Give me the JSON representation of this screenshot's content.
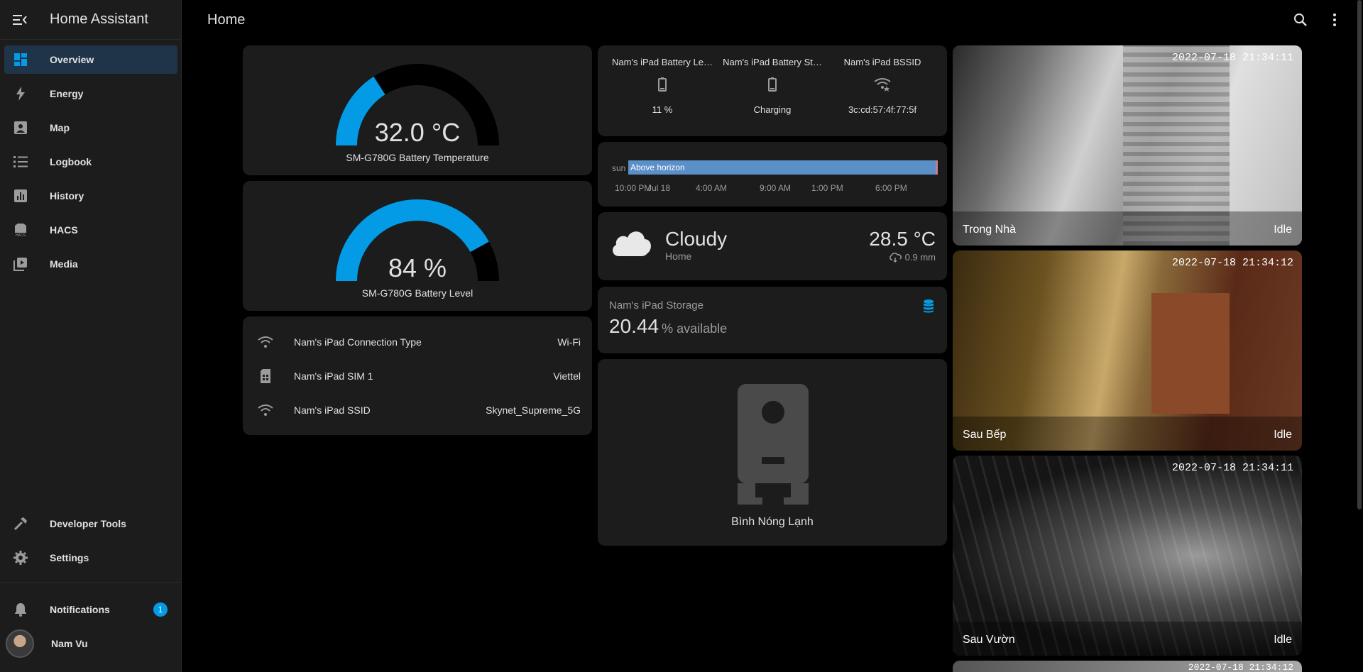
{
  "app": {
    "title": "Home Assistant",
    "page_title": "Home"
  },
  "colors": {
    "accent": "#039be5",
    "card": "#1c1c1c",
    "background": "#000000"
  },
  "sidebar": {
    "items": [
      {
        "label": "Overview",
        "icon": "view-dashboard-icon",
        "active": true
      },
      {
        "label": "Energy",
        "icon": "lightning-bolt-icon"
      },
      {
        "label": "Map",
        "icon": "map-account-icon"
      },
      {
        "label": "Logbook",
        "icon": "format-list-bulleted-icon"
      },
      {
        "label": "History",
        "icon": "chart-box-icon"
      },
      {
        "label": "HACS",
        "icon": "hacs-icon"
      },
      {
        "label": "Media",
        "icon": "play-box-multiple-icon"
      }
    ],
    "bottom": [
      {
        "label": "Developer Tools",
        "icon": "hammer-icon"
      },
      {
        "label": "Settings",
        "icon": "cog-icon"
      }
    ],
    "notifications": {
      "label": "Notifications",
      "count": "1"
    },
    "user": {
      "name": "Nam Vu"
    }
  },
  "gauges": [
    {
      "value": "32.0 °C",
      "name": "SM-G780G Battery Temperature",
      "fraction": 0.32
    },
    {
      "value": "84 %",
      "name": "SM-G780G Battery Level",
      "fraction": 0.84
    }
  ],
  "entities": [
    {
      "name": "Nam's iPad Connection Type",
      "value": "Wi-Fi",
      "icon": "wifi-icon"
    },
    {
      "name": "Nam's iPad SIM 1",
      "value": "Viettel",
      "icon": "sim-icon"
    },
    {
      "name": "Nam's iPad SSID",
      "value": "Skynet_Supreme_5G",
      "icon": "wifi-icon"
    }
  ],
  "glance": [
    {
      "name": "Nam's iPad Battery Le…",
      "value": "11 %",
      "icon": "battery-icon"
    },
    {
      "name": "Nam's iPad Battery St…",
      "value": "Charging",
      "icon": "battery-icon"
    },
    {
      "name": "Nam's iPad BSSID",
      "value": "3c:cd:57:4f:77:5f",
      "icon": "wifi-star-icon"
    }
  ],
  "history": {
    "entity": "sun",
    "state": "Above horizon",
    "ticks": [
      "10:00 PM",
      "Jul 18",
      "4:00 AM",
      "9:00 AM",
      "1:00 PM",
      "6:00 PM"
    ]
  },
  "weather": {
    "state": "Cloudy",
    "name": "Home",
    "temperature": "28.5 °C",
    "precipitation": "0.9 mm"
  },
  "sensor": {
    "name": "Nam's iPad Storage",
    "value": "20.44",
    "unit": "% available"
  },
  "picture_entity": {
    "name": "Bình Nóng Lạnh"
  },
  "cameras": [
    {
      "name": "Trong Nhà",
      "state": "Idle",
      "timestamp": "2022-07-18 21:34:11"
    },
    {
      "name": "Sau Bếp",
      "state": "Idle",
      "timestamp": "2022-07-18 21:34:12"
    },
    {
      "name": "Sau Vườn",
      "state": "Idle",
      "timestamp": "2022-07-18 21:34:11"
    },
    {
      "name": "",
      "state": "",
      "timestamp": "2022-07-18 21:34:12"
    }
  ]
}
